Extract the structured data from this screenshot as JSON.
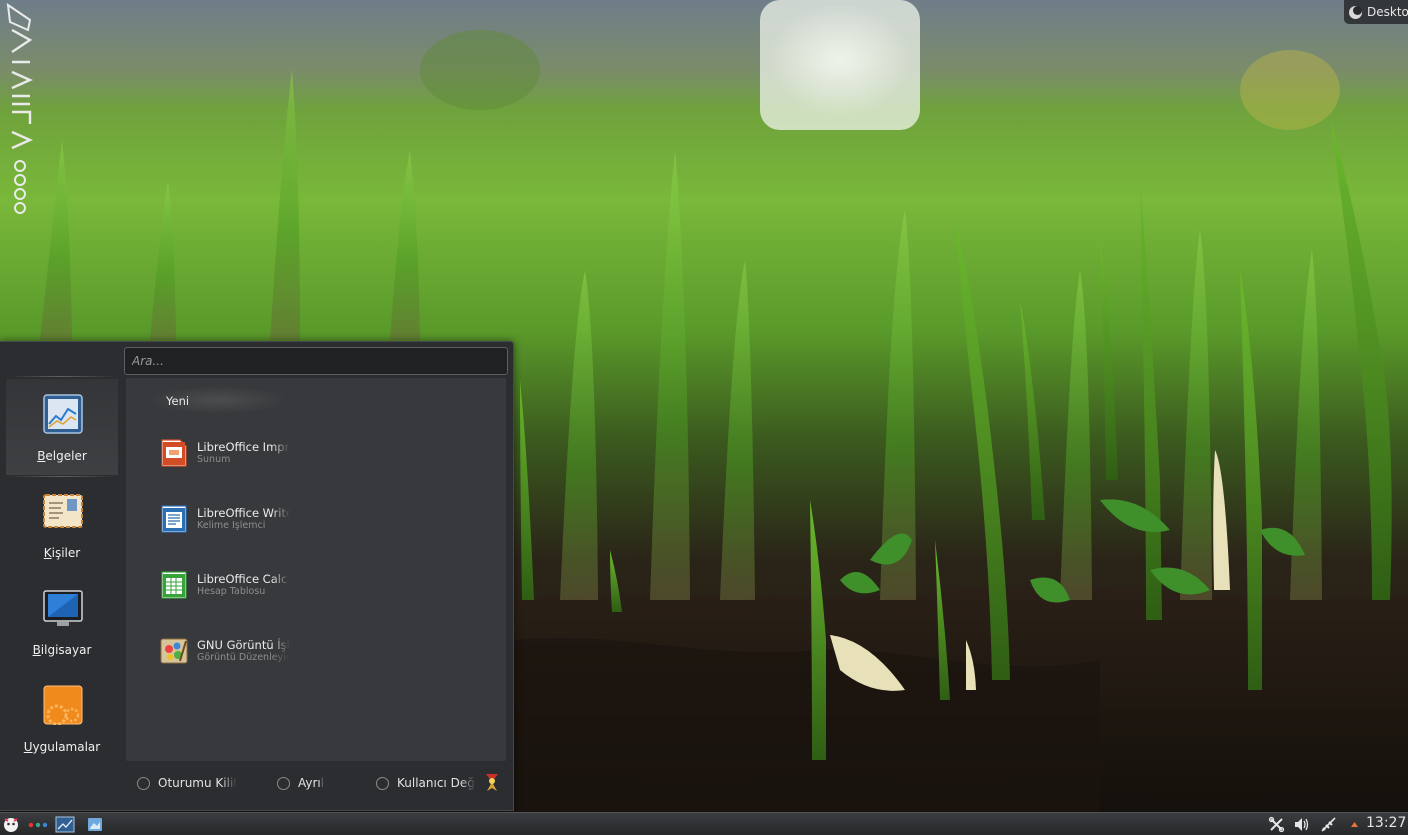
{
  "desktop_widget": {
    "label": "Desktop",
    "icon": "plasma-cashew-icon"
  },
  "launcher": {
    "search": {
      "placeholder": "Ara..."
    },
    "sidebar": [
      {
        "label": "Belgeler",
        "icon": "documents-chart-icon",
        "active": true
      },
      {
        "label": "Kişiler",
        "icon": "contacts-card-icon",
        "active": false
      },
      {
        "label": "Bilgisayar",
        "icon": "computer-monitor-icon",
        "active": false
      },
      {
        "label": "Uygulamalar",
        "icon": "applications-gears-icon",
        "active": false
      }
    ],
    "section_title": "Yeni",
    "apps": [
      {
        "name": "LibreOffice Impress",
        "description": "Sunum",
        "icon": "libreoffice-impress-icon",
        "color": "#d24c25"
      },
      {
        "name": "LibreOffice Writer",
        "description": "Kelime İşlemci",
        "icon": "libreoffice-writer-icon",
        "color": "#2b6fb5"
      },
      {
        "name": "LibreOffice Calc",
        "description": "Hesap Tablosu",
        "icon": "libreoffice-calc-icon",
        "color": "#37a33a"
      },
      {
        "name": "GNU Görüntü İşleme Programı",
        "description": "Görüntü Düzenleyici",
        "icon": "gimp-icon",
        "color": "#b88a3c"
      }
    ],
    "actions": [
      {
        "label": "Oturumu Kilitle",
        "icon": "lock-session-icon"
      },
      {
        "label": "Ayrıl",
        "icon": "power-icon"
      },
      {
        "label": "Kullanıcı Değiştir",
        "icon": "switch-user-icon"
      }
    ]
  },
  "taskbar": {
    "clock": "13:27",
    "items": [
      "application-launcher-icon",
      "activities-icon",
      "show-desktop-icon",
      "file-manager-icon"
    ],
    "tray": [
      "network-tools-icon",
      "volume-icon",
      "network-connection-icon",
      "expand-tray-arrow-icon"
    ]
  },
  "colors": {
    "accent": "#3a84c8",
    "panel_bg": "#2b2d30",
    "content_bg": "#38393c"
  }
}
